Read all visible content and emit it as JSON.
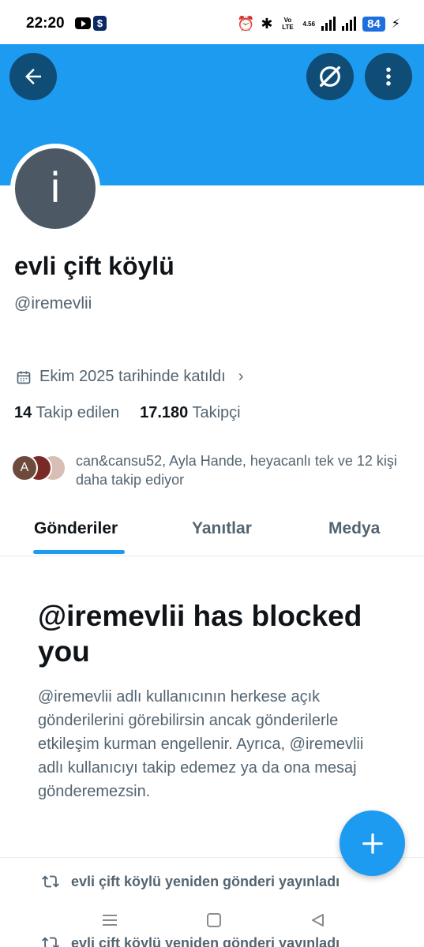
{
  "status_bar": {
    "time": "22:20",
    "lte_label": "Vo LTE",
    "net_speed": "4.56",
    "battery": "84"
  },
  "colors": {
    "banner": "#1d9bf0",
    "accent": "#1d9bf0",
    "header_button": "#0f4d77",
    "avatar_bg": "#4c5964"
  },
  "header": {
    "back_icon": "arrow-left-icon",
    "grok_icon": "grok-slash-circle-icon",
    "more_icon": "more-vertical-icon"
  },
  "profile": {
    "avatar_initial": "i",
    "display_name": "evli çift köylü",
    "handle": "@iremevlii",
    "joined": "Ekim 2025 tarihinde katıldı",
    "following_count": "14",
    "following_label": "Takip edilen",
    "followers_count": "17.180",
    "followers_label": "Takipçi",
    "followed_by_avatar_initial": "A",
    "followed_by_text": "can&cansu52, Ayla Hande, heyacanlı tek ve 12 kişi daha takip ediyor"
  },
  "tabs": [
    {
      "label": "Gönderiler",
      "active": true
    },
    {
      "label": "Yanıtlar",
      "active": false
    },
    {
      "label": "Medya",
      "active": false
    }
  ],
  "blocked": {
    "title": "@iremevlii has blocked you",
    "body": "@iremevlii adlı kullanıcının herkese açık gönderilerini görebilirsin ancak gönderilerle etkileşim kurman engellenir. Ayrıca, @iremevlii adlı kullanıcıyı takip edemez ya da ona mesaj gönderemezsin."
  },
  "reposts": [
    {
      "text": "evli çift köylü yeniden gönderi yayınladı"
    },
    {
      "text": "evli çift köylü yeniden gönderi yayınladı"
    }
  ]
}
